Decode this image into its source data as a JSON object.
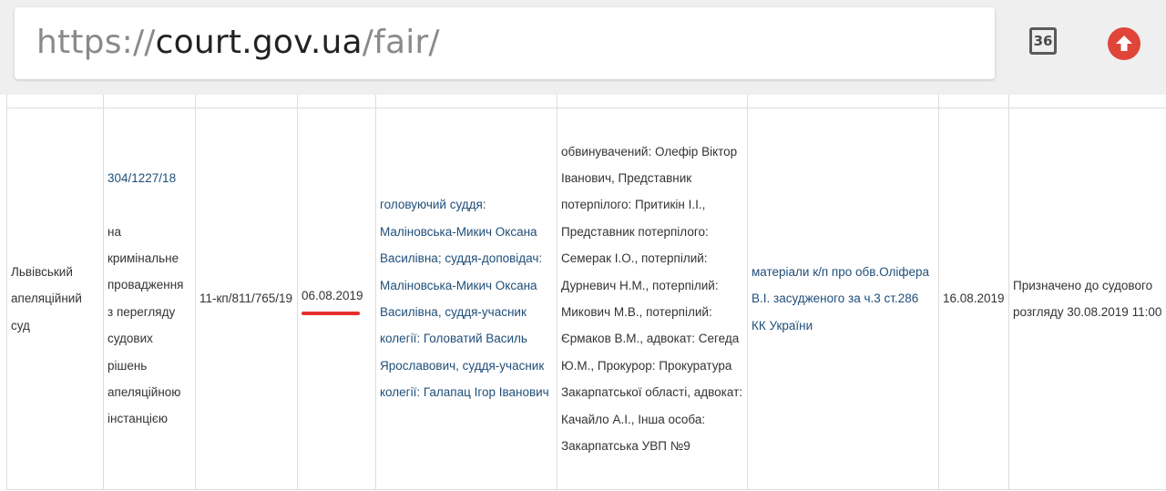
{
  "browser": {
    "url_scheme": "https://",
    "url_domain": "court.gov.ua",
    "url_path": "/fair/",
    "tab_count": "36"
  },
  "row": {
    "court": "Львівський апеляційний суд",
    "case_number": "304/1227/18",
    "case_type": "на кримінальне провадження з перегляду судових рішень апеляційною інстанцією",
    "proceeding_number": "11-кп/811/765/19",
    "receipt_date": "06.08.2019",
    "judges": "головуючий суддя: Маліновська-Микич Оксана Василівна; суддя-доповідач: Маліновська-Микич Оксана Василівна, суддя-учасник колегії: Головатий Василь Ярославович, суддя-учасник колегії: Галапац Ігор Іванович",
    "parties": "обвинувачений: Олефір Віктор Іванович, Представник потерпілого: Притикін І.І., Представник потерпілого: Семерак І.О., потерпілий: Дурневич Н.М., потерпілий: Микович М.В., потерпілий: Єрмаков В.М., адвокат: Сегеда Ю.М., Прокурор: Прокуратура Закарпатської області, адвокат: Качайло А.І., Інша особа: Закарпатська УВП №9",
    "subject": "матеріали к/п про обв.Оліфера В.І. засудженого за ч.3 ст.286 КК України",
    "event_date": "16.08.2019",
    "status": "Призначено до судового розгляду 30.08.2019 11:00"
  }
}
